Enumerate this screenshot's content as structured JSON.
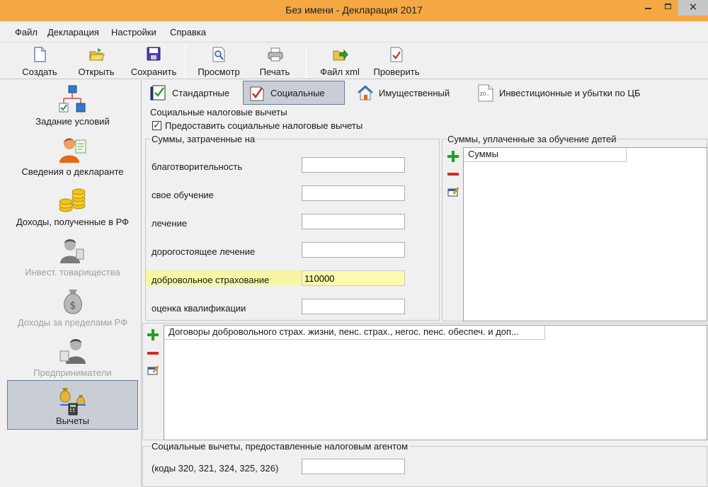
{
  "window": {
    "title": "Без имени - Декларация 2017",
    "close": "✕"
  },
  "menu": [
    "Файл",
    "Декларация",
    "Настройки",
    "Справка"
  ],
  "toolbar": {
    "create": "Создать",
    "open": "Открыть",
    "save": "Сохранить",
    "preview": "Просмотр",
    "print": "Печать",
    "xml": "Файл xml",
    "check": "Проверить"
  },
  "sidebar": {
    "items": [
      {
        "label": "Задание условий",
        "icon": "conditions-icon",
        "state": "enabled"
      },
      {
        "label": "Сведения о декларанте",
        "icon": "declarant-icon",
        "state": "enabled"
      },
      {
        "label": "Доходы, полученные в РФ",
        "icon": "coins-icon",
        "state": "enabled"
      },
      {
        "label": "Инвест. товарищества",
        "icon": "investor-icon",
        "state": "disabled"
      },
      {
        "label": "Доходы за пределами РФ",
        "icon": "money-bag-icon",
        "state": "disabled"
      },
      {
        "label": "Предприниматели",
        "icon": "entrepreneur-icon",
        "state": "disabled"
      },
      {
        "label": "Вычеты",
        "icon": "deductions-icon",
        "state": "active"
      }
    ]
  },
  "tabs": [
    {
      "label": "Стандартные",
      "icon": "standard-icon",
      "active": false
    },
    {
      "label": "Социальные",
      "icon": "social-icon",
      "active": true
    },
    {
      "label": "Имущественный",
      "icon": "house-icon",
      "active": false
    },
    {
      "label": "Инвестиционные и убытки по ЦБ",
      "icon": "investment-icon",
      "active": false
    }
  ],
  "social": {
    "group_title": "Социальные налоговые вычеты",
    "provide_checkbox": {
      "label": "Предоставить социальные налоговые вычеты",
      "checked": true
    },
    "spent_group_title": "Суммы, затраченные на",
    "fields": [
      {
        "label": "благотворительность",
        "value": ""
      },
      {
        "label": "свое обучение",
        "value": ""
      },
      {
        "label": "лечение",
        "value": ""
      },
      {
        "label": "дорогостоящее лечение",
        "value": ""
      },
      {
        "label": "добровольное страхование",
        "value": "110000"
      },
      {
        "label": "оценка квалификации",
        "value": ""
      }
    ],
    "children_group_title": "Суммы, уплаченные за обучение детей",
    "children_grid_header": "Суммы",
    "contracts_grid_header": "Договоры добровольного страх. жизни, пенс. страх., негос. пенс. обеспеч. и доп...",
    "agent_group_title": "Социальные вычеты, предоставленные налоговым агентом",
    "agent_label": "(коды 320, 321, 324, 325, 326)",
    "agent_value": ""
  },
  "colors": {
    "titlebar": "#f4a742",
    "highlight": "#f7f6a4",
    "active_item": "#c9cdd6",
    "add": "#21a321",
    "remove": "#d42828"
  }
}
